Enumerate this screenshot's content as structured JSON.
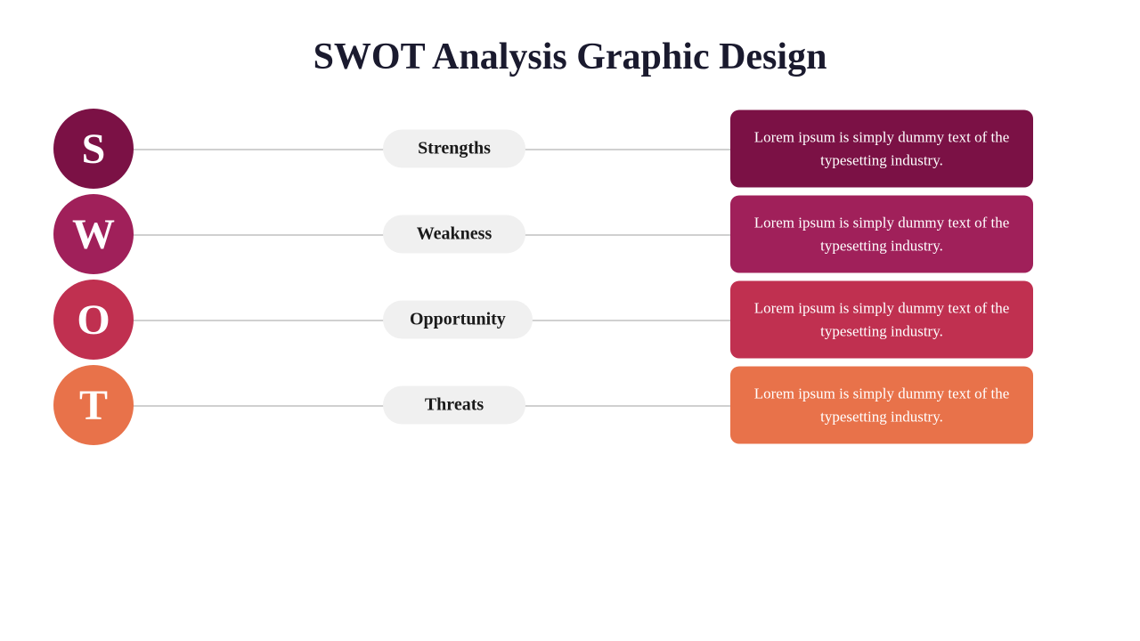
{
  "title": "SWOT Analysis Graphic Design",
  "rows": [
    {
      "id": "s",
      "letter": "S",
      "label": "Strengths",
      "text": "Lorem ipsum is simply dummy text of the typesetting industry.",
      "circleClass": "circle-s",
      "textBoxClass": "text-box-s"
    },
    {
      "id": "w",
      "letter": "W",
      "label": "Weakness",
      "text": "Lorem ipsum is simply dummy text of the typesetting industry.",
      "circleClass": "circle-w",
      "textBoxClass": "text-box-w"
    },
    {
      "id": "o",
      "letter": "O",
      "label": "Opportunity",
      "text": "Lorem ipsum is simply dummy text of the typesetting industry.",
      "circleClass": "circle-o",
      "textBoxClass": "text-box-o"
    },
    {
      "id": "t",
      "letter": "T",
      "label": "Threats",
      "text": "Lorem ipsum is simply dummy text of the typesetting industry.",
      "circleClass": "circle-t",
      "textBoxClass": "text-box-t"
    }
  ]
}
